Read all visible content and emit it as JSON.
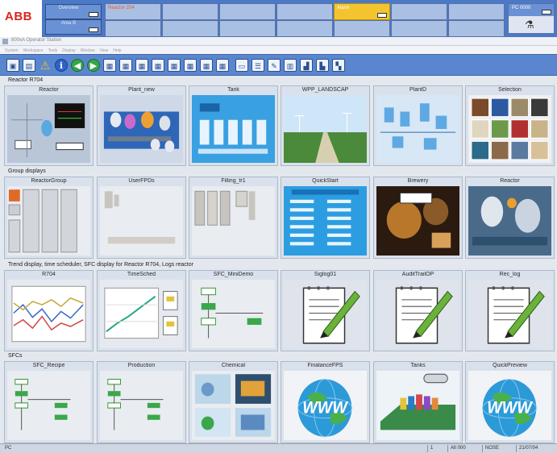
{
  "brand": {
    "logo": "ABB",
    "accent": "#d7261e"
  },
  "top_bar": {
    "area_boxes": [
      {
        "label": "Overview"
      },
      {
        "label": "Area B"
      }
    ],
    "alarm_cells_row1": [
      {
        "text": "Reactor 204"
      },
      {
        "text": ""
      },
      {
        "text": ""
      },
      {
        "text": ""
      },
      {
        "text": "Alarm",
        "color": "#f4c430"
      },
      {
        "text": ""
      },
      {
        "text": ""
      }
    ],
    "right_box": {
      "label": "PC 0000",
      "icon": "chemistry-icon"
    }
  },
  "window": {
    "title": "800xA Operator Station",
    "menu": [
      "System",
      "Workspace",
      "Tools",
      "Display",
      "Window",
      "View",
      "Help"
    ]
  },
  "toolbar": {
    "buttons": [
      {
        "name": "workplace-icon",
        "glyph": "▣"
      },
      {
        "name": "group-icon",
        "glyph": "▤"
      },
      {
        "name": "alarm-warning-icon",
        "glyph": "⚠"
      },
      {
        "name": "info-icon",
        "glyph": "ℹ"
      },
      {
        "name": "back-icon",
        "glyph": "◀"
      },
      {
        "name": "forward-icon",
        "glyph": "▶"
      },
      {
        "name": "display-1-icon",
        "glyph": "▦"
      },
      {
        "name": "display-2-icon",
        "glyph": "▦"
      },
      {
        "name": "display-3-icon",
        "glyph": "▦"
      },
      {
        "name": "display-4-icon",
        "glyph": "▦"
      },
      {
        "name": "display-5-icon",
        "glyph": "▦"
      },
      {
        "name": "display-6-icon",
        "glyph": "▦"
      },
      {
        "name": "display-7-icon",
        "glyph": "▦"
      },
      {
        "name": "display-8-icon",
        "glyph": "▦"
      },
      {
        "name": "trend-icon",
        "glyph": "▭"
      },
      {
        "name": "list-icon",
        "glyph": "☰"
      },
      {
        "name": "tools-icon",
        "glyph": "✎"
      },
      {
        "name": "layout-icon",
        "glyph": "▥"
      },
      {
        "name": "chart-icon",
        "glyph": "▟"
      },
      {
        "name": "level-icon",
        "glyph": "▙"
      },
      {
        "name": "batch-icon",
        "glyph": "▚"
      }
    ]
  },
  "groups": [
    {
      "title": "Reactor R704",
      "tiles": [
        {
          "label": "Reactor",
          "art": "reactor"
        },
        {
          "label": "Plant_new",
          "art": "plant"
        },
        {
          "label": "Tank",
          "art": "tank"
        },
        {
          "label": "WPP_LANDSCAP",
          "art": "landscape"
        },
        {
          "label": "PlantD",
          "art": "plantd"
        },
        {
          "label": "Selection",
          "art": "selection"
        }
      ]
    },
    {
      "title": "Group displays",
      "tiles": [
        {
          "label": "ReactorGroup",
          "art": "group"
        },
        {
          "label": "UserFPDs",
          "art": "userfpd"
        },
        {
          "label": "Filling_tr1",
          "art": "filling"
        },
        {
          "label": "QuickStart",
          "art": "quickstart"
        },
        {
          "label": "Brewery",
          "art": "brewery"
        },
        {
          "label": "Reactor",
          "art": "reactor2"
        }
      ]
    },
    {
      "title": "Trend display, time scheduler, SFC display for Reactor R704, Logs reactor",
      "tiles": [
        {
          "label": "R704",
          "art": "trend"
        },
        {
          "label": "TimeSched",
          "art": "timesched"
        },
        {
          "label": "SFC_MiniDemo",
          "art": "sfc"
        },
        {
          "label": "Siglog01",
          "art": "log"
        },
        {
          "label": "AuditTrailOP",
          "art": "log"
        },
        {
          "label": "Rec_log",
          "art": "log"
        }
      ]
    },
    {
      "title": "SFCs",
      "tiles": [
        {
          "label": "SFC_Recipe",
          "art": "sfc2"
        },
        {
          "label": "Production",
          "art": "sfc2"
        },
        {
          "label": "Chemical",
          "art": "chemical"
        },
        {
          "label": "FinalanceFPS",
          "art": "www"
        },
        {
          "label": "Tanks",
          "art": "tanks2"
        },
        {
          "label": "QuickPreview",
          "art": "www"
        }
      ]
    }
  ],
  "status_bar": {
    "left": "PC",
    "cells": [
      "1",
      "Alt 000",
      "NOSE",
      "21/07/04"
    ]
  }
}
